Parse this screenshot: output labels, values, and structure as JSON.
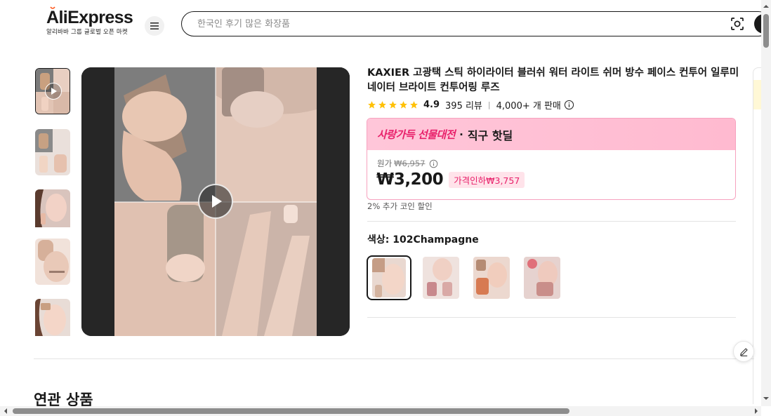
{
  "header": {
    "logo_text": "AliExpress",
    "logo_sub": "알리바바 그룹 글로벌 오픈 마켓",
    "menu_icon": "hamburger-menu-icon",
    "search_placeholder": "한국인 후기 많은 화장품",
    "camera_icon": "camera-search-icon"
  },
  "product": {
    "title": "KAXIER 고광택 스틱 하이라이터 블러쉬 워터 라이트 쉬머 방수 페이스 컨투어 일루미네이터 브라이트 컨투어링 루즈",
    "rating": "4.9",
    "reviews": "395 리뷰",
    "sold": "4,000+ 개 판매",
    "rating_stars": 5
  },
  "promo": {
    "brand": "사랑가득 선물대전",
    "separator": "·",
    "label": "직구 핫딜",
    "original_label": "원가",
    "original_price": "₩6,957",
    "price": "₩3,200",
    "discount_badge": "가격인하₩3,757",
    "coin_note": "2% 추가 코인 할인"
  },
  "options": {
    "color_label": "색상: 102Champagne",
    "swatches": [
      "102Champagne",
      "option-2",
      "option-3",
      "option-4"
    ],
    "selected_index": 0
  },
  "related": {
    "heading": "연관 상품"
  },
  "colors": {
    "accent": "#e8206a",
    "star": "#ffc107",
    "promo_bg": "#ffc1d6",
    "text": "#191919"
  }
}
